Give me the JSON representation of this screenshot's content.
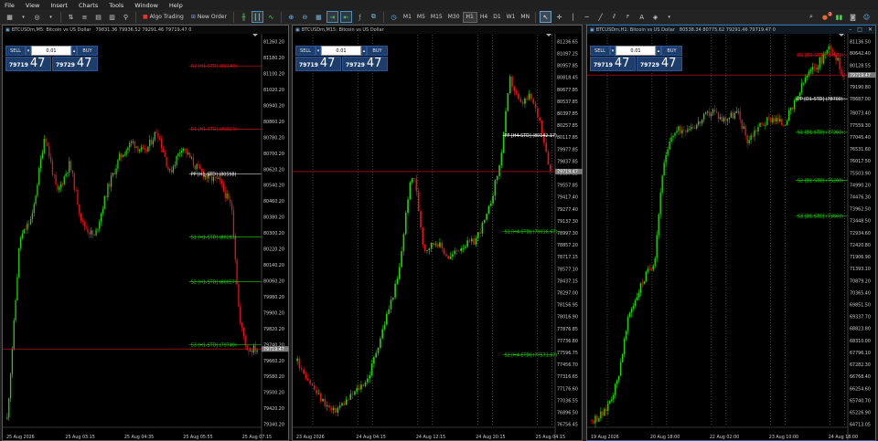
{
  "menu": [
    "File",
    "View",
    "Insert",
    "Charts",
    "Tools",
    "Window",
    "Help"
  ],
  "toolbar": {
    "algo_trading": "Algo Trading",
    "new_order": "New Order",
    "timeframes": [
      "M1",
      "M5",
      "M15",
      "M30",
      "H1",
      "H4",
      "D1",
      "W1",
      "MN"
    ],
    "active_timeframe": "H1",
    "notification_count": "2"
  },
  "trade_panel": {
    "sell_label": "SELL",
    "buy_label": "BUY",
    "lot": "0.01",
    "bid_main": "79719",
    "bid_big": "47",
    "ask_main": "79729",
    "ask_big": "47"
  },
  "colors": {
    "bull": "#22d400",
    "bear": "#e8121a",
    "pivot": "#ffffff",
    "support": "#22d400",
    "resistance": "#e8121a",
    "ask_line": "#e8121a",
    "grid": "#8a8a8a"
  },
  "windows": [
    {
      "title": "BTCUSDm,M5:  Bitcoin vs US Dollar",
      "ohlc": "79831.36 79936.52 79291.46 79719.47  0",
      "price_axis": [
        "81260.20",
        "81180.20",
        "81100.20",
        "81020.20",
        "80940.20",
        "80860.20",
        "80780.20",
        "80700.20",
        "80620.20",
        "80540.20",
        "80460.20",
        "80380.20",
        "80300.20",
        "80220.20",
        "80140.20",
        "80060.20",
        "79980.20",
        "79900.20",
        "79820.20",
        "79740.20",
        "79660.20",
        "79580.20",
        "79500.20",
        "79420.20",
        "79340.20"
      ],
      "time_axis": [
        "25 Aug 2026",
        "25 Aug 03:15",
        "25 Aug 04:35",
        "25 Aug 05:55",
        "25 Aug 07:15"
      ],
      "current_price": "79719.47",
      "levels": [
        {
          "label": "R2 [H1-STD] (81140)",
          "type": "resistance"
        },
        {
          "label": "R1 [H1-STD] (80823)",
          "type": "resistance"
        },
        {
          "label": "PP [H1-STD] (80598)",
          "type": "pivot"
        },
        {
          "label": "S1 [H1-STD] (80281)",
          "type": "support"
        },
        {
          "label": "S2 [H1-STD] (80057)",
          "type": "support"
        },
        {
          "label": "S3 [H1-STD] (79740)",
          "type": "support"
        }
      ]
    },
    {
      "title": "BTCUSDm,M15:  Bitcoin vs US Dollar",
      "ohlc": "",
      "price_axis": [
        "81236.65",
        "81097.25",
        "80957.85",
        "80818.45",
        "80677.85",
        "80537.85",
        "80397.85",
        "80257.85",
        "80117.85",
        "79977.85",
        "79837.85",
        "79697.85",
        "79557.85",
        "79417.40",
        "79277.40",
        "79137.30",
        "78997.30",
        "78857.20",
        "78717.15",
        "78577.10",
        "78437.15",
        "78297.00",
        "78156.95",
        "78016.90",
        "77876.85",
        "77736.80",
        "77596.75",
        "77456.70",
        "77316.65",
        "77176.60",
        "77036.55",
        "76896.50",
        "76756.45"
      ],
      "time_axis": [
        "23 Aug 2026",
        "24 Aug 04:15",
        "24 Aug 12:15",
        "24 Aug 20:15",
        "25 Aug 04:15"
      ],
      "current_price": "79719.47",
      "levels": [
        {
          "label": "PP [H4-STD] (80142.17)",
          "type": "pivot"
        },
        {
          "label": "S1 [H4-STD] (79016.67)",
          "type": "support"
        },
        {
          "label": "S2 [H4-STD] (77571.67)",
          "type": "support"
        }
      ]
    },
    {
      "title": "BTCUSDm,H1:  Bitcoin vs US Dollar",
      "ohlc": "80538.34 80775.62 79291.46 79719.47  0",
      "price_axis": [
        "81136.50",
        "80642.40",
        "80128.55",
        "79719.47",
        "79190.80",
        "78687.00",
        "78073.40",
        "77559.30",
        "77045.40",
        "76531.60",
        "76017.50",
        "75503.90",
        "74990.20",
        "74476.30",
        "73962.50",
        "73448.50",
        "72934.60",
        "72420.80",
        "71906.90",
        "71393.10",
        "70879.20",
        "70365.40",
        "69851.50",
        "69337.70",
        "68823.80",
        "68310.00",
        "67796.10",
        "67282.30",
        "66768.40",
        "66254.60",
        "65740.70",
        "65226.90",
        "64713.05"
      ],
      "time_axis": [
        "19 Aug 2026",
        "20 Aug 18:00",
        "22 Aug 02:00",
        "23 Aug 10:00",
        "24 Aug 18:00"
      ],
      "current_price": "79719.47",
      "levels": [
        {
          "label": "R1 [D1-STD] (80583)",
          "type": "resistance"
        },
        {
          "label": "PP [D1-STD] (78700)",
          "type": "pivot"
        },
        {
          "label": "S1 [D1-STD] (77260)",
          "type": "support"
        },
        {
          "label": "S2 [D1-STD] (75200)",
          "type": "support"
        },
        {
          "label": "S3 [D1-STD] (73660)",
          "type": "support"
        }
      ]
    }
  ]
}
